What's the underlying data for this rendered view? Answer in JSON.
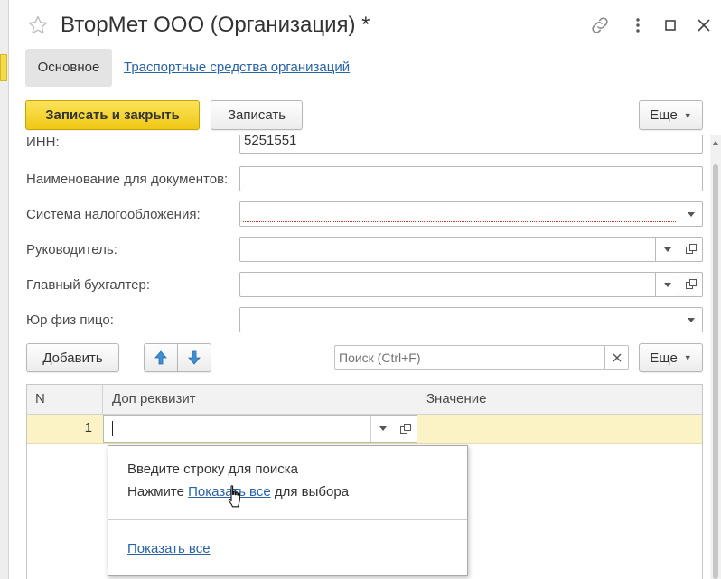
{
  "window": {
    "title": "ВторМет ООО (Организация) *",
    "favorite_icon": "star-icon",
    "link_icon": "link-icon",
    "menu_icon": "more-vertical-icon",
    "maximize_icon": "maximize-icon",
    "close_icon": "close-icon"
  },
  "nav": {
    "tabs": [
      {
        "label": "Основное",
        "active": true
      },
      {
        "label": "Траспортные средства организаций",
        "active": false
      }
    ]
  },
  "toolbar": {
    "save_close_label": "Записать и закрыть",
    "save_label": "Записать",
    "more_label": "Еще"
  },
  "form": {
    "inn": {
      "label": "ИНН:",
      "value": "5251551"
    },
    "doc_name": {
      "label": "Наименование для документов:",
      "value": ""
    },
    "tax_system": {
      "label": "Система налогообложения:",
      "value": ""
    },
    "director": {
      "label": "Руководитель:",
      "value": ""
    },
    "chief_accountant": {
      "label": "Главный бухгалтер:",
      "value": ""
    },
    "legal_form": {
      "label": "Юр физ пицо:",
      "value": ""
    }
  },
  "table_toolbar": {
    "add_label": "Добавить",
    "search_placeholder": "Поиск (Ctrl+F)",
    "more_label": "Еще"
  },
  "table": {
    "columns": [
      "N",
      "Доп реквизит",
      "Значение"
    ],
    "rows": [
      {
        "n": "1",
        "attribute": "",
        "value": ""
      }
    ]
  },
  "popup": {
    "line1": "Введите строку для поиска",
    "line2_prefix": "Нажмите ",
    "line2_link": "Показать все",
    "line2_suffix": " для выбора",
    "show_all_link": "Показать все"
  },
  "colors": {
    "primary_button": "#f4d430",
    "link": "#2a63a6",
    "selected_row": "#fbf2c5",
    "required_underline": "#c0392b"
  }
}
